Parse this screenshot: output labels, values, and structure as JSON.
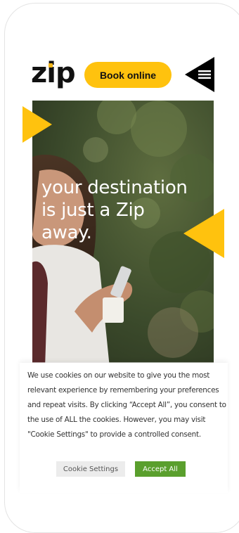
{
  "header": {
    "logo_text": "zip",
    "book_label": "Book online",
    "menu_icon": "hamburger-icon"
  },
  "hero": {
    "title_lines": [
      "your destination",
      "is just a Zip",
      "away."
    ]
  },
  "cookie_banner": {
    "text": "We use cookies on our website to give you the most relevant experience by remembering your preferences and repeat visits. By clicking “Accept All”, you consent to the use of ALL the cookies. However, you may visit \"Cookie Settings\" to provide a controlled consent.",
    "settings_label": "Cookie Settings",
    "accept_label": "Accept All"
  },
  "colors": {
    "brand_yellow": "#ffc20e",
    "accept_green": "#5a9f2d",
    "logo_black": "#111111"
  }
}
